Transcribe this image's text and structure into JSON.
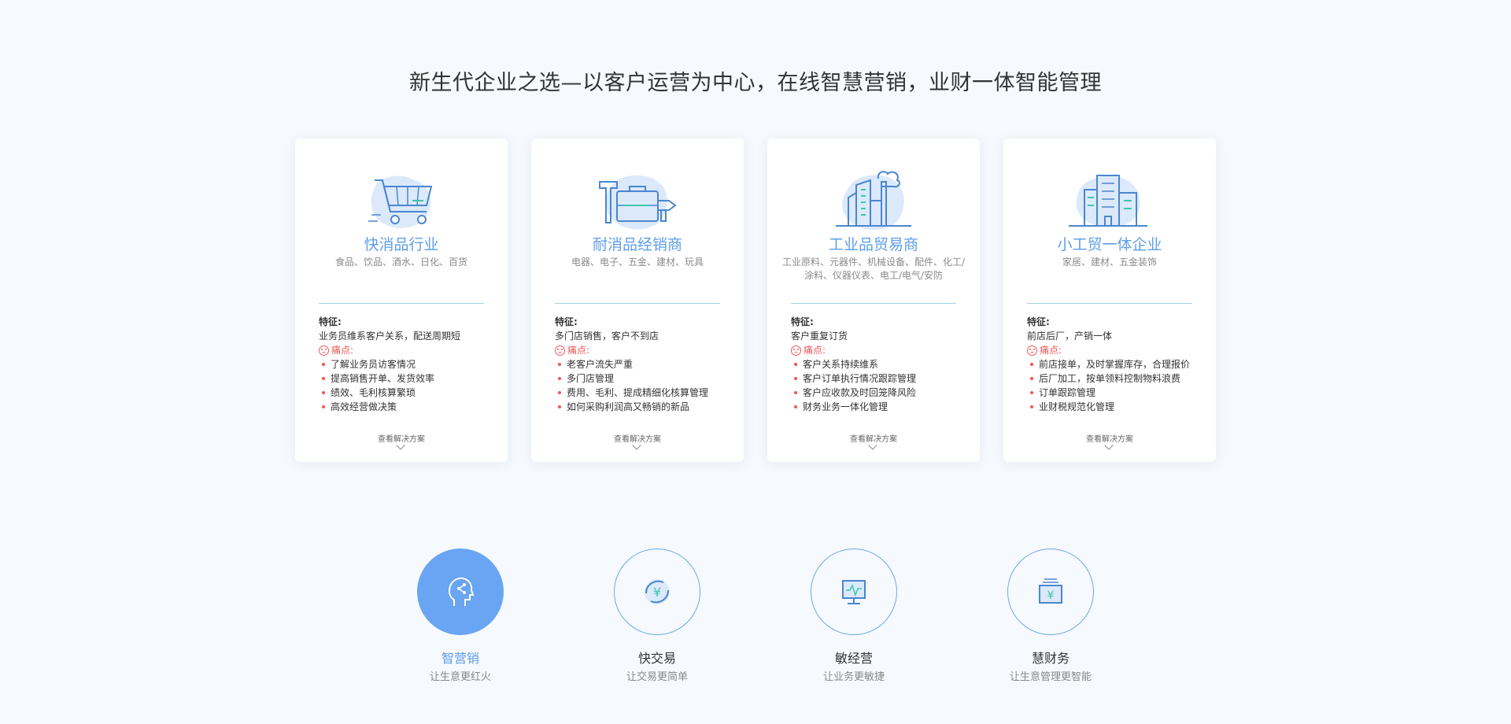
{
  "headline": "新生代企业之选—以客户运营为中心，在线智慧营销，业财一体智能管理",
  "labels": {
    "feature_title": "特征:",
    "pain_title": "痛点:",
    "more": "查看解决方案"
  },
  "cards": [
    {
      "icon": "shopping-cart-icon",
      "title": "快消品行业",
      "subtitle": "食品、饮品、酒水、日化、百货",
      "feature": "业务员维系客户关系，配送周期短",
      "pains": [
        "了解业务员访客情况",
        "提高销售开单、发货效率",
        "绩效、毛利核算繁琐",
        "高效经营做决策"
      ]
    },
    {
      "icon": "tools-icon",
      "title": "耐消品经销商",
      "subtitle": "电器、电子、五金、建材、玩具",
      "feature": "多门店销售，客户不到店",
      "pains": [
        "老客户流失严重",
        "多门店管理",
        "费用、毛利、提成精细化核算管理",
        "如何采购利润高又畅销的新品"
      ]
    },
    {
      "icon": "factory-icon",
      "title": "工业品贸易商",
      "subtitle": "工业原料、元器件、机械设备、配件、化工/涂料、仪器仪表、电工/电气/安防",
      "feature": "客户重复订货",
      "pains": [
        "客户关系持续维系",
        "客户订单执行情况跟踪管理",
        "客户应收款及时回笼降风险",
        "财务业务一体化管理"
      ]
    },
    {
      "icon": "building-icon",
      "title": "小工贸一体企业",
      "subtitle": "家居、建材、五金装饰",
      "feature": "前店后厂，产销一体",
      "pains": [
        "前店接单，及时掌握库存，合理报价",
        "后厂加工，按单领料控制物料浪费",
        "订单跟踪管理",
        "业财税规范化管理"
      ]
    }
  ],
  "features": [
    {
      "icon": "smart-head-icon",
      "title": "智营销",
      "subtitle": "让生意更红火",
      "active": true
    },
    {
      "icon": "yuan-exchange-icon",
      "title": "快交易",
      "subtitle": "让交易更简单",
      "active": false
    },
    {
      "icon": "monitor-pulse-icon",
      "title": "敏经营",
      "subtitle": "让业务更敏捷",
      "active": false
    },
    {
      "icon": "wallet-yuan-icon",
      "title": "慧财务",
      "subtitle": "让生意管理更智能",
      "active": false
    }
  ],
  "colors": {
    "accent": "#5d9ee9",
    "active_circle": "#69a5f2",
    "pain": "#f25555",
    "separator": "#9fd3e3",
    "background": "#f6f9fd"
  }
}
